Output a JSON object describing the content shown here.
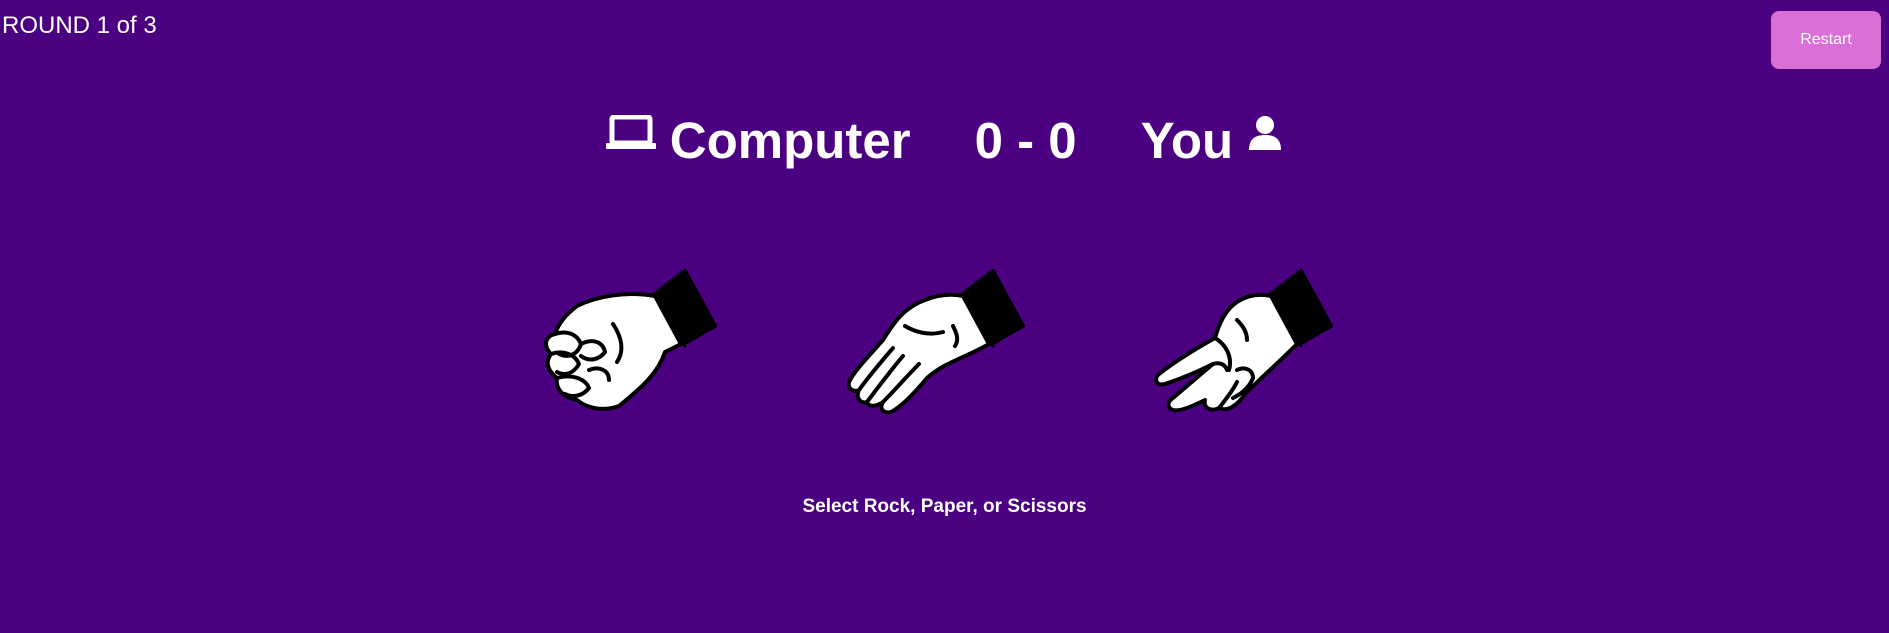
{
  "round": {
    "label": "ROUND 1 of 3"
  },
  "header": {
    "restart_label": "Restart"
  },
  "scoreboard": {
    "computer_label": "Computer",
    "score": "0 - 0",
    "user_label": "You",
    "computer_icon": "laptop-icon",
    "user_icon": "person-icon"
  },
  "choices": [
    {
      "name": "Rock",
      "icon": "rock-hand-icon"
    },
    {
      "name": "Paper",
      "icon": "paper-hand-icon"
    },
    {
      "name": "Scissors",
      "icon": "scissors-hand-icon"
    }
  ],
  "prompt": "Select Rock, Paper, or Scissors",
  "colors": {
    "background": "#4b0082",
    "restart_button": "#da70d6",
    "text": "#ffffff"
  }
}
